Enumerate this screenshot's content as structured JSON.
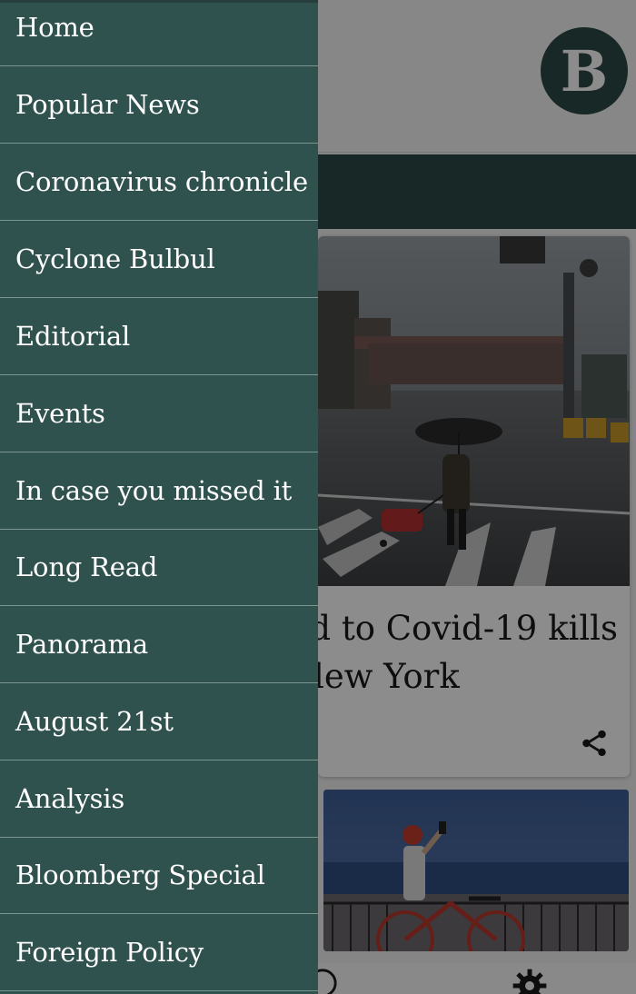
{
  "drawer": {
    "items": [
      {
        "label": "Home"
      },
      {
        "label": "Popular News"
      },
      {
        "label": "Coronavirus chronicle"
      },
      {
        "label": "Cyclone Bulbul"
      },
      {
        "label": "Editorial"
      },
      {
        "label": "Events"
      },
      {
        "label": "In case you missed it"
      },
      {
        "label": "Long Read"
      },
      {
        "label": "Panorama"
      },
      {
        "label": "August 21st"
      },
      {
        "label": "Analysis"
      },
      {
        "label": "Bloomberg Special"
      },
      {
        "label": "Foreign Policy"
      }
    ]
  },
  "app": {
    "logo_letter": "B",
    "card1": {
      "headline_line1": "d to Covid-19 kills",
      "headline_line2": "lew York"
    },
    "icons": {
      "share": "share-icon",
      "settings": "gear-icon",
      "nav_left": "help-icon"
    }
  },
  "colors": {
    "drawer_bg": "#2f524f",
    "drawer_divider": "#7a9591",
    "brand": "#2d4a47",
    "text_on_drawer": "#ffffff"
  }
}
